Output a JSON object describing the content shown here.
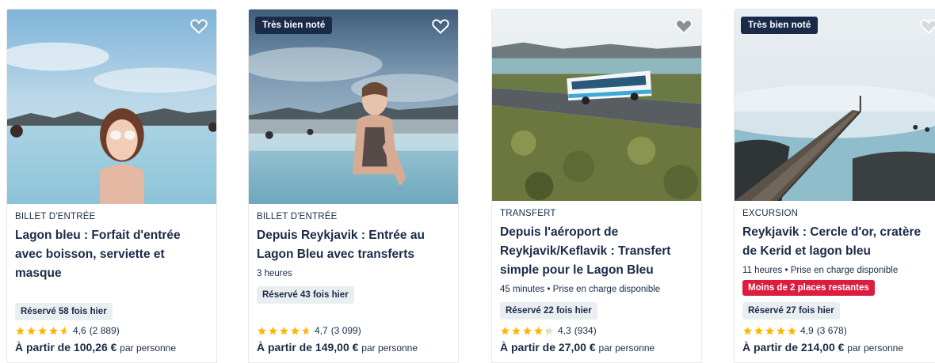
{
  "cards": [
    {
      "badge": "",
      "category": "BILLET D'ENTRÉE",
      "title": "Lagon bleu : Forfait d'entrée avec boisson, serviette et masque",
      "meta": "",
      "scarcity": "",
      "booked": "Réservé 58 fois hier",
      "rating": 4.6,
      "rating_text": "4,6",
      "reviews": "(2 889)",
      "price_prefix": "À partir de 100,26 €",
      "price_unit": "par personne"
    },
    {
      "badge": "Très bien noté",
      "category": "BILLET D'ENTRÉE",
      "title": "Depuis Reykjavik : Entrée au Lagon Bleu avec transferts",
      "meta": "3 heures",
      "scarcity": "",
      "booked": "Réservé 43 fois hier",
      "rating": 4.7,
      "rating_text": "4,7",
      "reviews": "(3 099)",
      "price_prefix": "À partir de 149,00 €",
      "price_unit": "par personne"
    },
    {
      "badge": "",
      "category": "TRANSFERT",
      "title": "Depuis l'aéroport de Reykjavik/Keflavik : Transfert simple pour le Lagon Bleu",
      "meta": "45 minutes • Prise en charge disponible",
      "scarcity": "",
      "booked": "Réservé 22 fois hier",
      "rating": 4.3,
      "rating_text": "4,3",
      "reviews": "(934)",
      "price_prefix": "À partir de 27,00 €",
      "price_unit": "par personne"
    },
    {
      "badge": "Très bien noté",
      "category": "EXCURSION",
      "title": "Reykjavik : Cercle d'or, cratère de Kerid et lagon bleu",
      "meta": "11 heures • Prise en charge disponible",
      "scarcity": "Moins de 2 places restantes",
      "booked": "Réservé 27 fois hier",
      "rating": 4.9,
      "rating_text": "4,9",
      "reviews": "(3 678)",
      "price_prefix": "À partir de 214,00 €",
      "price_unit": "par personne"
    }
  ],
  "colors": {
    "text": "#1a2b49",
    "badge_bg": "#1a2b49",
    "scarcity_bg": "#dc1d3f",
    "booked_bg": "#ebeef1",
    "star": "#ffb800"
  },
  "icons": {
    "wishlist": "heart-icon",
    "rating": "star-icon"
  }
}
